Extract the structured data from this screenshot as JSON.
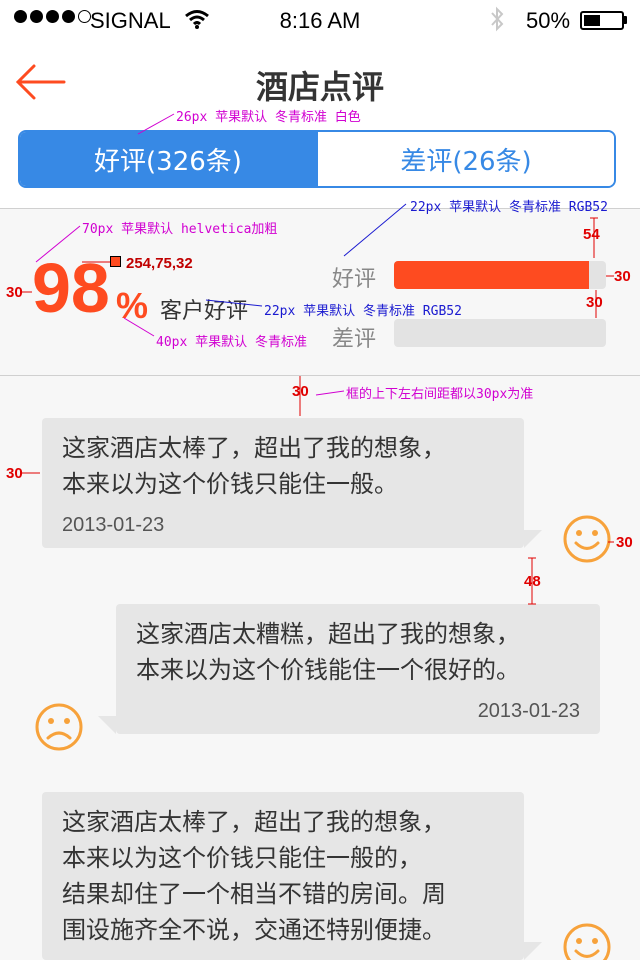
{
  "status_bar": {
    "carrier": "SIGNAL",
    "time": "8:16 AM",
    "battery": "50%",
    "battery_level": 0.5
  },
  "nav": {
    "title": "酒店点评",
    "back_icon": "back-arrow-icon"
  },
  "tabs": [
    {
      "label": "好评(326条)",
      "active": true
    },
    {
      "label": "差评(26条)",
      "active": false
    }
  ],
  "summary": {
    "rate_value": "98",
    "rate_unit": "%",
    "rate_label": "客户好评",
    "good_label": "好评",
    "bad_label": "差评",
    "good_fill": 0.92,
    "bad_fill": 0.0
  },
  "annotations": {
    "tab_spec": "26px 苹果默认 冬青标准 白色",
    "big_number_spec": "70px 苹果默认 helvetica加粗",
    "color_spec": "254,75,32",
    "bar_label_spec": "22px 苹果默认 冬青标准 RGB52",
    "rate_label_spec": "22px 苹果默认 冬青标准 RGB52",
    "pct_spec": "40px 苹果默认 冬青标准",
    "box_spacing_note": "框的上下左右间距都以30px为准",
    "dim_30": "30",
    "dim_54": "54",
    "dim_48": "48"
  },
  "comments": [
    {
      "text": "这家酒店太棒了，超出了我的想象，\n本来以为这个价钱只能住一般。",
      "date": "2013-01-23",
      "side": "left",
      "mood": "smile-icon"
    },
    {
      "text": "这家酒店太糟糕，超出了我的想象，\n本来以为这个价钱能住一个很好的。",
      "date": "2013-01-23",
      "side": "right",
      "mood": "sad-icon"
    },
    {
      "text": "这家酒店太棒了，超出了我的想象，\n本来以为这个价钱只能住一般的，\n结果却住了一个相当不错的房间。周\n围设施齐全不说，交通还特别便捷。",
      "date": "",
      "side": "left",
      "mood": "smile-icon"
    }
  ],
  "colors": {
    "accent_blue": "#3789e5",
    "accent_orange": "#fe4b20",
    "face_orange": "#f7a23b",
    "bubble_gray": "#e6e6e6"
  }
}
